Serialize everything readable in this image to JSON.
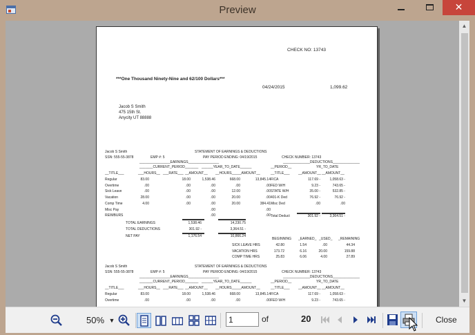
{
  "window": {
    "title": "Preview"
  },
  "report": {
    "check_number": "CHECK NO: 13743",
    "amount_words": "***One Thousand Ninety-Nine and 62/100 Dollars***",
    "check_date": "04/24/2015",
    "check_amount": "1,099.62",
    "payee": [
      "Jacob S Smith",
      "475 15th St.",
      "Anycity  UT  88888"
    ],
    "stub_header": {
      "name": "Jacob S Smith",
      "ssn": "SSN: 555-55-3878",
      "emp": "EMP #: 5",
      "title": "STATEMENT OF EARNINGS & DEDUCTIONS",
      "period": "PAY PERIOD ENDING: 04/19/2015",
      "check": "CHECK NUMBER:  13743",
      "earnings": "________________EARNINGS________________",
      "deductions": "______________DEDUCTIONS______________",
      "current": "_______CURRENT_PERIOD_______",
      "ytd": "______YEAR_TO_DATE______",
      "period_col": "__PERIOD__",
      "ytd_col": "YR_TO_DATE"
    },
    "col_titles": [
      "__TITLE___",
      "___HOURS__",
      "___RATE___",
      "__AMOUNT__",
      "__HOURS___",
      "__AMOUNT__",
      "__TITLE___",
      "__AMOUNT__",
      "__AMOUNT__"
    ],
    "earnings_rows": [
      [
        "Regular",
        "83.00",
        "18.00",
        "1,538.46",
        "668.00",
        "13,845.14"
      ],
      [
        "Overtime",
        ".00",
        ".00",
        ".00",
        ".00",
        ".00"
      ],
      [
        "Sick Leave",
        ".00",
        ".00",
        ".00",
        "12.00",
        ".00"
      ],
      [
        "Vacation",
        "28.00",
        ".00",
        ".00",
        "20.00",
        ".00"
      ],
      [
        "Comp Time",
        "4.00",
        ".00",
        ".00",
        "20.00",
        "384.41"
      ],
      [
        "Misc Pay",
        "",
        "",
        ".00",
        "",
        ".00"
      ],
      [
        "REIMBURS",
        "",
        "",
        ".00",
        "",
        ".00"
      ]
    ],
    "deduction_rows": [
      [
        "FICA",
        "117.69 -",
        "1,058.63 -"
      ],
      [
        "FED W/H",
        "9.23 -",
        "743.65 -"
      ],
      [
        "STATE W/H",
        "35.00 -",
        "532.85 -"
      ],
      [
        "401-K Ded",
        "76.92 -",
        "76.92 -"
      ],
      [
        "Misc Ded",
        ".00",
        ".00"
      ],
      [
        "Total Deduct",
        "301.92 -",
        "3,364.51 -"
      ]
    ],
    "totals": [
      [
        "TOTAL EARNINGS",
        "1,538.46",
        "14,230.75"
      ],
      [
        "TOTAL DEDUCTIONS",
        "301.92 -",
        "3,364.51 -"
      ],
      [
        "NET PAY",
        "1,176.54",
        "10,866.24"
      ]
    ],
    "leave_header": [
      "BEGINNING",
      "_EARNED_",
      "_USED_",
      "_REMAINING"
    ],
    "leave_rows": [
      [
        "SICK LEAVE HRS",
        "42.80",
        "1.54",
        ".00",
        "44.34"
      ],
      [
        "VACATION HRS",
        "173.72",
        "6.16",
        "20.00",
        "159.88"
      ],
      [
        "COMP TIME HRS",
        "25.83",
        "6.06",
        "4.00",
        "27.89"
      ]
    ],
    "stub2_rows": [
      [
        "Regular",
        "83.00",
        "18.00",
        "1,538.46",
        "668.00",
        "13,845.14"
      ],
      [
        "Overtime",
        ".00",
        ".00",
        ".00",
        ".00",
        ".00"
      ]
    ],
    "stub2_deductions": [
      [
        "FICA",
        "117.69 -",
        "1,058.63 -"
      ],
      [
        "FED W/H",
        "9.23 -",
        "743.65 -"
      ]
    ]
  },
  "toolbar": {
    "zoom_value": "50%",
    "page_value": "1",
    "of_label": "of",
    "page_total": "20",
    "close_label": "Close"
  }
}
